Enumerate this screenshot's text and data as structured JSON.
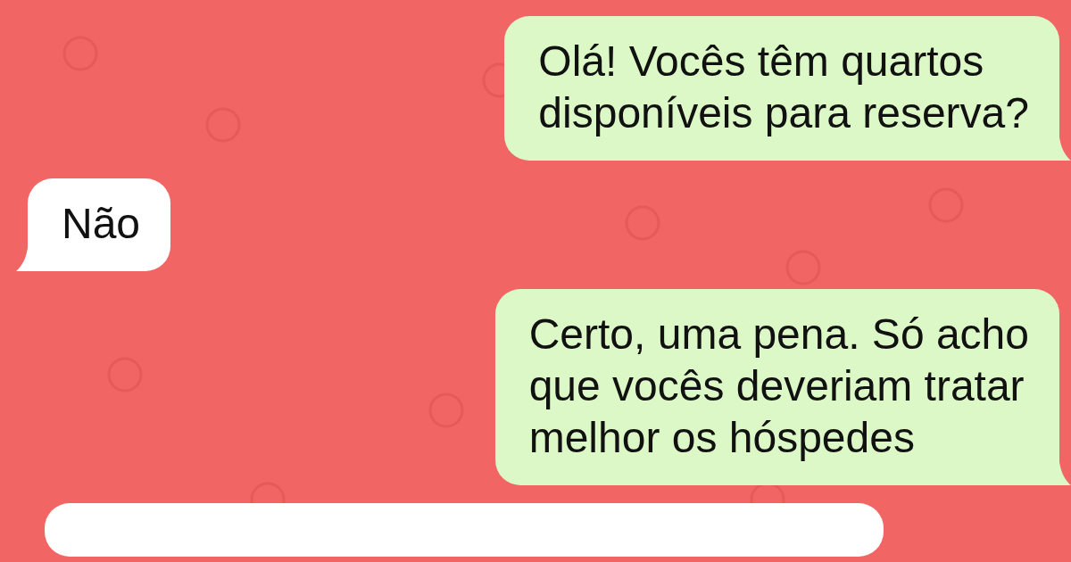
{
  "messages": [
    {
      "kind": "outgoing",
      "text": "Olá! Vocês têm quartos\ndisponíveis para reserva?",
      "tail": true
    },
    {
      "kind": "incoming",
      "text": "Não",
      "tail": true
    },
    {
      "kind": "outgoing",
      "text": "Certo, uma pena. Só acho\nque vocês deveriam tratar\nmelhor os hóspedes",
      "tail": true
    },
    {
      "kind": "incoming",
      "tail": false
    }
  ]
}
